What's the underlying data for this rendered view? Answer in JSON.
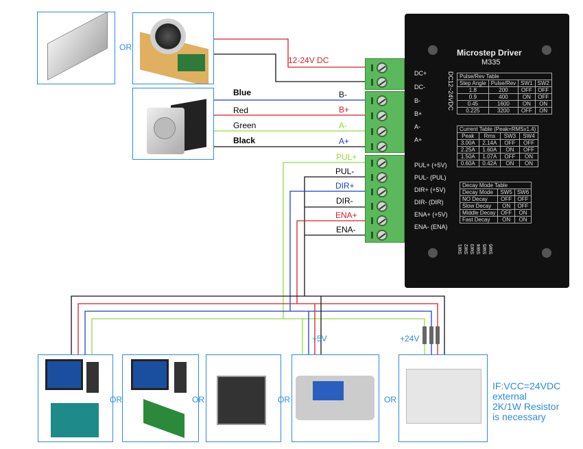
{
  "power": {
    "or_label": "OR",
    "label": "12-24V DC"
  },
  "motor_wires": [
    {
      "name": "Blue",
      "terminal": "B-",
      "color": "#1a3fcc"
    },
    {
      "name": "Red",
      "terminal": "B+",
      "color": "#d42020"
    },
    {
      "name": "Green",
      "terminal": "A-",
      "color": "#8ee03a"
    },
    {
      "name": "Black",
      "terminal": "A+",
      "color": "#111111"
    }
  ],
  "signal_terminals": [
    {
      "label": "PUL+",
      "color": "#8ee03a"
    },
    {
      "label": "PUL-",
      "color": "#111111"
    },
    {
      "label": "DIR+",
      "color": "#1a3fcc"
    },
    {
      "label": "DIR-",
      "color": "#111111"
    },
    {
      "label": "ENA+",
      "color": "#d42020"
    },
    {
      "label": "ENA-",
      "color": "#111111"
    }
  ],
  "driver": {
    "title": "Microstep Driver",
    "model": "M335",
    "supply_text": "DC12~24VDC",
    "power_terms": [
      "DC+",
      "DC-",
      "B-",
      "B+",
      "A-",
      "A+"
    ],
    "signal_terms": [
      "PUL+ (+5V)",
      "PUL- (PUL)",
      "DIR+ (+5V)",
      "DIR- (DIR)",
      "ENA+ (+5V)",
      "ENA- (ENA)"
    ],
    "pulse_table": {
      "title": "Pulse/Rev  Table",
      "headers": [
        "Step Angle",
        "Pulse/Rev",
        "SW1",
        "SW2"
      ],
      "rows": [
        [
          "1.8",
          "200",
          "OFF",
          "OFF"
        ],
        [
          "0.9",
          "400",
          "ON",
          "OFF"
        ],
        [
          "0.45",
          "1600",
          "ON",
          "ON"
        ],
        [
          "0.225",
          "3200",
          "OFF",
          "ON"
        ]
      ]
    },
    "current_table": {
      "title": "Current  Table",
      "note": "(Peak=RMSx1.4)",
      "headers": [
        "Peak",
        "Rms",
        "SW3",
        "SW4"
      ],
      "rows": [
        [
          "3.00A",
          "2.14A",
          "OFF",
          "OFF"
        ],
        [
          "2.25A",
          "1.60A",
          "ON",
          "OFF"
        ],
        [
          "1.50A",
          "1.07A",
          "OFF",
          "ON"
        ],
        [
          "0.60A",
          "0.42A",
          "ON",
          "ON"
        ]
      ]
    },
    "decay_table": {
      "title": "Decay Mode Table",
      "headers": [
        "Decay Mode",
        "SW5",
        "SW6"
      ],
      "rows": [
        [
          "NO Decay",
          "OFF",
          "OFF"
        ],
        [
          "Slow Decay",
          "ON",
          "OFF"
        ],
        [
          "Middle Decay",
          "OFF",
          "ON"
        ],
        [
          "Fast Decay",
          "ON",
          "ON"
        ]
      ]
    },
    "switches": [
      "SW1",
      "SW2",
      "SW3",
      "SW4",
      "SW5",
      "SW6"
    ]
  },
  "controllers": {
    "or_label": "OR",
    "v5_label": "+5V",
    "v24_label": "+24V"
  },
  "note": [
    "IF:VCC=24VDC",
    "external",
    "2K/1W Resistor",
    "is necessary"
  ],
  "colors": {
    "accent": "#2a8be0",
    "terminal_green": "#5cb85c",
    "driver_body": "#111111"
  }
}
